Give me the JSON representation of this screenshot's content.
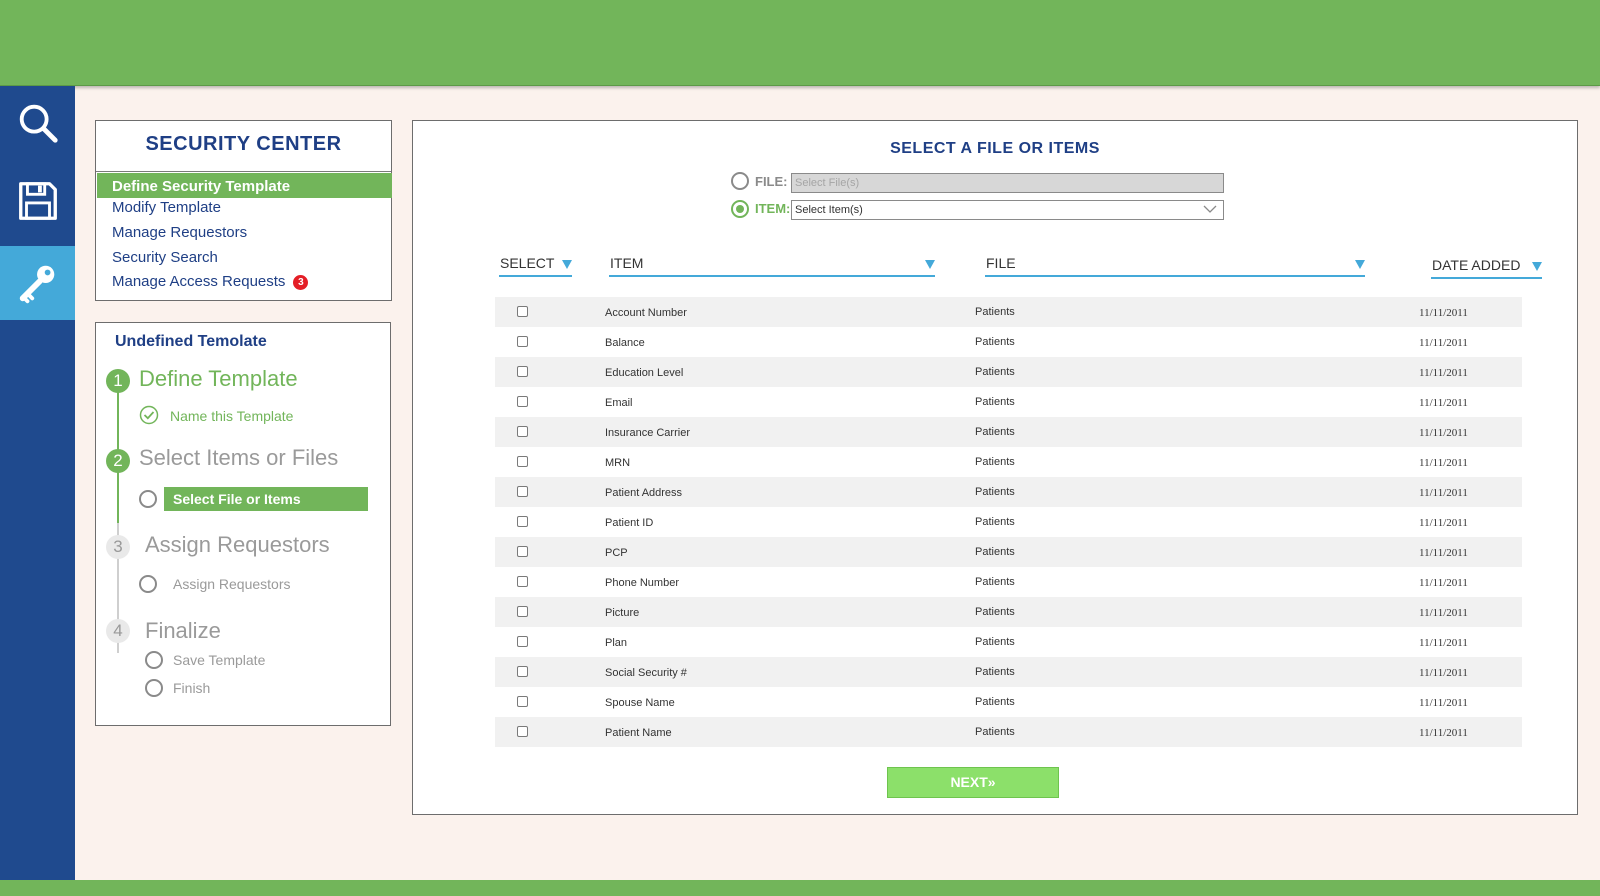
{
  "colors": {
    "green": "#72b55a",
    "navy": "#1f4a8e",
    "accent_blue": "#44a9d9",
    "title_blue": "#1f3f85",
    "badge_red": "#e41e26",
    "next_green": "#8ce06a"
  },
  "sidenav": {
    "icons": [
      "search-icon",
      "save-icon",
      "key-icon"
    ],
    "active": "key-icon"
  },
  "security_center": {
    "title": "SECURITY CENTER",
    "active_item": "Define Security Template",
    "items": [
      "Modify Template",
      "Manage Requestors",
      "Security Search",
      "Manage Access Requests"
    ],
    "badge": "3"
  },
  "wizard": {
    "title": "Undefined Temolate",
    "steps": [
      {
        "number": "1",
        "label": "Define Template",
        "status": "done",
        "subs": [
          "Name this Template"
        ]
      },
      {
        "number": "2",
        "label": "Select Items or Files",
        "status": "current",
        "subs": [
          "Select File or Items"
        ]
      },
      {
        "number": "3",
        "label": "Assign Requestors",
        "status": "pending",
        "subs": [
          "Assign Requestors"
        ]
      },
      {
        "number": "4",
        "label": "Finalize",
        "status": "pending",
        "subs": [
          "Save Template",
          "Finish"
        ]
      }
    ]
  },
  "main": {
    "title": "SELECT A FILE OR ITEMS",
    "file_label": "FILE:",
    "file_placeholder": "Select File(s)",
    "item_label": "ITEM:",
    "item_value": "Select Item(s)",
    "selected_radio": "item",
    "columns": [
      "SELECT",
      "ITEM",
      "FILE",
      "DATE ADDED"
    ],
    "rows": [
      {
        "item": "Account Number",
        "file": "Patients",
        "date": "11/11/2011"
      },
      {
        "item": "Balance",
        "file": "Patients",
        "date": "11/11/2011"
      },
      {
        "item": "Education Level",
        "file": "Patients",
        "date": "11/11/2011"
      },
      {
        "item": "Email",
        "file": "Patients",
        "date": "11/11/2011"
      },
      {
        "item": "Insurance Carrier",
        "file": "Patients",
        "date": "11/11/2011"
      },
      {
        "item": "MRN",
        "file": "Patients",
        "date": "11/11/2011"
      },
      {
        "item": "Patient Address",
        "file": "Patients",
        "date": "11/11/2011"
      },
      {
        "item": "Patient ID",
        "file": "Patients",
        "date": "11/11/2011"
      },
      {
        "item": "PCP",
        "file": "Patients",
        "date": "11/11/2011"
      },
      {
        "item": "Phone Number",
        "file": "Patients",
        "date": "11/11/2011"
      },
      {
        "item": "Picture",
        "file": "Patients",
        "date": "11/11/2011"
      },
      {
        "item": "Plan",
        "file": "Patients",
        "date": "11/11/2011"
      },
      {
        "item": "Social Security #",
        "file": "Patients",
        "date": "11/11/2011"
      },
      {
        "item": "Spouse Name",
        "file": "Patients",
        "date": "11/11/2011"
      },
      {
        "item": "Patient Name",
        "file": "Patients",
        "date": "11/11/2011"
      }
    ],
    "next_label": "NEXT»"
  }
}
